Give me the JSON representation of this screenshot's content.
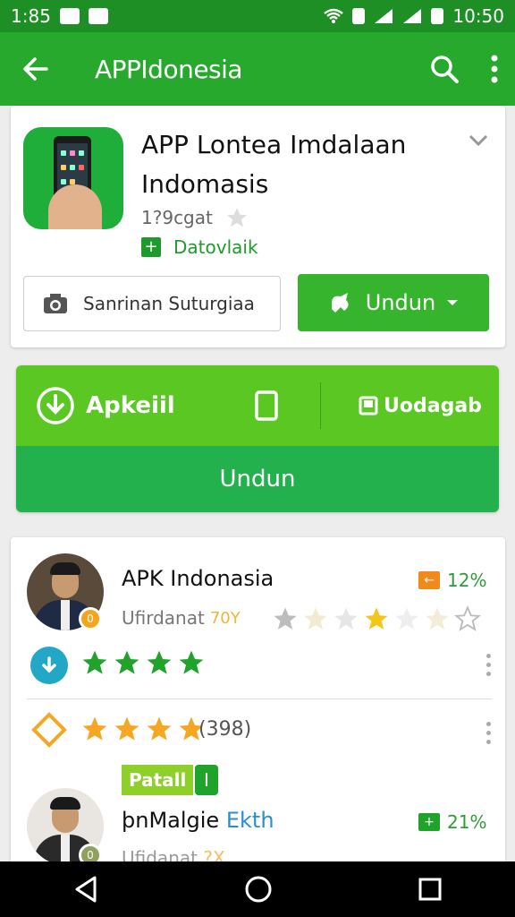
{
  "status_bar": {
    "time_left": "1:85",
    "time_right": "10:50",
    "icons": [
      "vk-icon",
      "n-icon",
      "wifi-icon",
      "vibrate-icon",
      "signal-icon",
      "signal-icon",
      "battery-icon"
    ]
  },
  "app_bar": {
    "title": "APPIdonesia",
    "icons": [
      "back-arrow-icon",
      "search-icon",
      "overflow-menu-icon"
    ]
  },
  "app_card": {
    "title": "APP Lontea Imdalaan Indomasis",
    "rating_text": "1?9cgat",
    "developer": "Datovlaik",
    "secondary_button": "Sanrinan Suturgiaa",
    "install_button": "Undun",
    "colors": {
      "primary": "#26a92c",
      "accent": "#36b42d"
    }
  },
  "banner": {
    "left_label": "Apkeiil",
    "right_label": "Uodagab",
    "cta": "Undun",
    "colors": {
      "top": "#5ac723",
      "bottom": "#22b14c"
    }
  },
  "reviews": {
    "items": [
      {
        "name": "APK Indonasia",
        "subtitle": "Ufirdanat",
        "year": "70Y",
        "percent": "12%",
        "percent_icon_color": "#f08a1c",
        "star_rating": 2,
        "download_stars": 4
      },
      {
        "rating_count": "(398)",
        "rating_stars": 4,
        "tag": "Patall",
        "tag2": "I",
        "name_part1": "þnMalgie",
        "name_part2": "Ekth",
        "percent": "21%",
        "percent_icon_color": "#1fa32a",
        "subtitle": "Ufidanat",
        "year": "?X"
      }
    ]
  }
}
